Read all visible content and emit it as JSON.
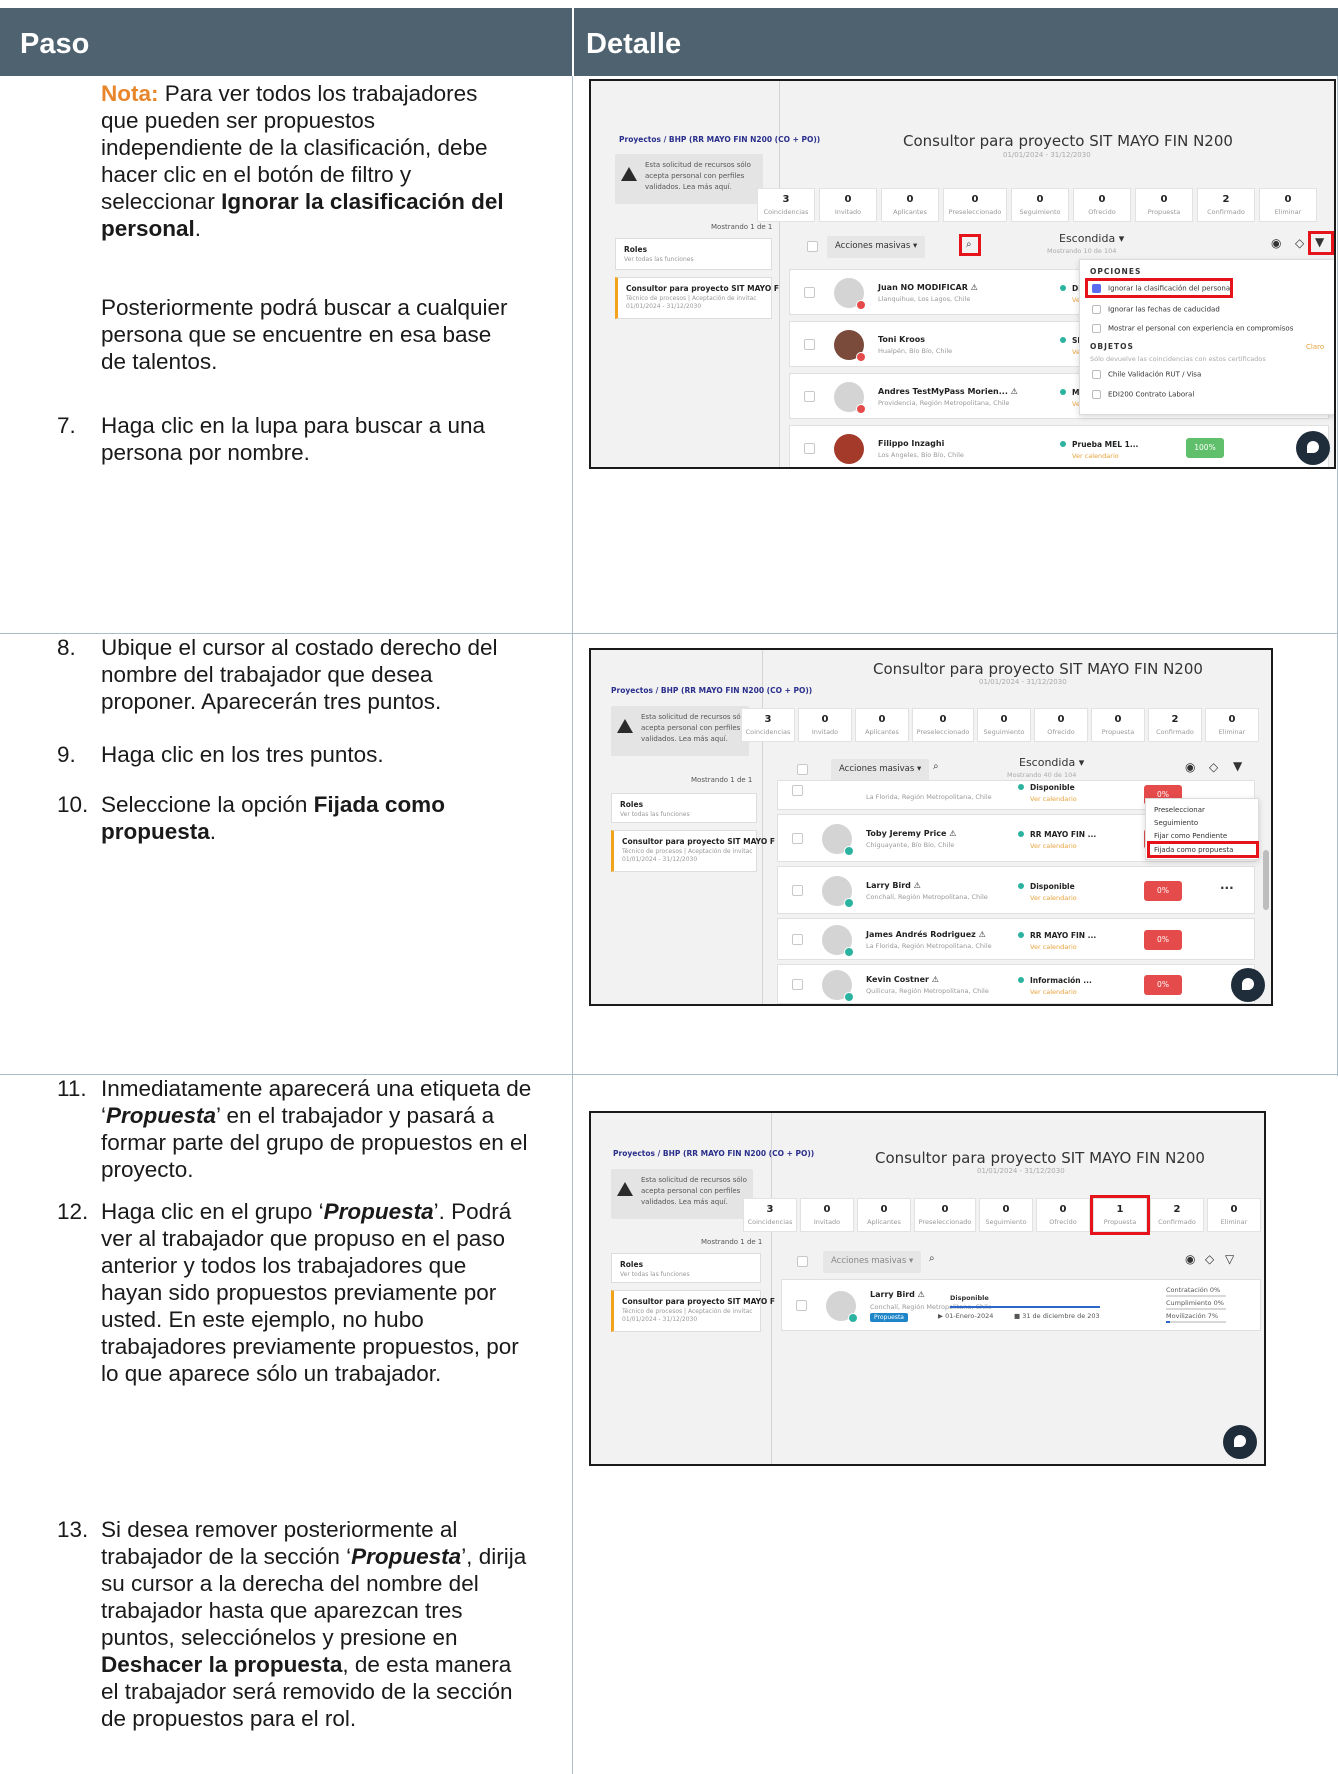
{
  "table": {
    "col1_header": "Paso",
    "col2_header": "Detalle"
  },
  "row1": {
    "note_label": "Nota:",
    "note_text_1": "Para ver todos los trabajadores",
    "note_text_2": "que pueden ser propuestos",
    "note_text_3": "independiente de la clasificación, debe",
    "note_text_4": "hacer clic en el botón de filtro y",
    "note_text_5": "seleccionar",
    "note_bold_1": "Ignorar la clasificación del",
    "note_bold_2": "personal",
    "note_period": ".",
    "later_1": "Posteriormente podrá buscar a cualquier",
    "later_2": "persona que se encuentre en esa base",
    "later_3": "de talentos.",
    "step7_num": "7.",
    "step7_1": "Haga clic en la lupa para buscar a una",
    "step7_2": "persona por nombre."
  },
  "row2": {
    "step8_num": "8.",
    "step8_1": "Ubique el cursor al costado derecho del",
    "step8_2": "nombre del trabajador que desea",
    "step8_3": "proponer. Aparecerán tres puntos.",
    "step9_num": "9.",
    "step9_1": "Haga clic en los tres puntos.",
    "step10_num": "10.",
    "step10_1": "Seleccione la opción",
    "step10_bold_1": "Fijada como",
    "step10_bold_2": "propuesta",
    "step10_period": "."
  },
  "row3": {
    "step11_num": "11.",
    "step11_1": "Inmediatamente aparecerá una etiqueta de",
    "step11_q1": "‘",
    "step11_bold": "Propuesta",
    "step11_q2": "’ en el trabajador y pasará a",
    "step11_2": "formar parte del grupo de propuestos en el",
    "step11_3": "proyecto.",
    "step12_num": "12.",
    "step12_1a": "Haga clic en el grupo ‘",
    "step12_bold": "Propuesta",
    "step12_1b": "’. Podrá",
    "step12_2": "ver al trabajador que propuso en el paso",
    "step12_3": "anterior y todos los trabajadores que",
    "step12_4": "hayan sido propuestos previamente por",
    "step12_5": "usted. En este ejemplo, no hubo",
    "step12_6": "trabajadores previamente propuestos, por",
    "step12_7": "lo que aparece sólo un trabajador.",
    "step13_num": "13.",
    "step13_1": "Si desea remover posteriormente al",
    "step13_2a": "trabajador de la sección ‘",
    "step13_bold": "Propuesta",
    "step13_2b": "’, dirija",
    "step13_3": "su cursor a la derecha del nombre del",
    "step13_4": "trabajador hasta que aparezcan tres",
    "step13_5": "puntos, selecciónelos y presione en",
    "step13_bold2": "Deshacer la propuesta",
    "step13_6": ", de esta manera",
    "step13_7": "el trabajador será removido de la sección",
    "step13_8": "de propuestos para el rol."
  },
  "app": {
    "breadcrumb": "Proyectos  /  BHP (RR MAYO FIN N200 (CO + PO))",
    "notice_1": "Esta solicitud de recursos sólo",
    "notice_2": "acepta personal con perfiles",
    "notice_3": "validados. Lea más aquí.",
    "mostrando": "Mostrando 1 de 1",
    "roles_title": "Roles",
    "roles_sub": "Ver todas las funciones",
    "role_title": "Consultor para proyecto SIT MAYO F",
    "role_sub_1": "Técnico de procesos | Aceptación de invitac",
    "role_sub_2": "01/01/2024 - 31/12/2030",
    "page_title": "Consultor para proyecto SIT MAYO FIN N200",
    "page_dates": "01/01/2024 - 31/12/2030",
    "stats": [
      {
        "n": "3",
        "l": "Coincidencias"
      },
      {
        "n": "0",
        "l": "Invitado"
      },
      {
        "n": "0",
        "l": "Aplicantes"
      },
      {
        "n": "0",
        "l": "Preseleccionado"
      },
      {
        "n": "0",
        "l": "Seguimiento"
      },
      {
        "n": "0",
        "l": "Ofrecido"
      },
      {
        "n": "0",
        "l": "Propuesta"
      },
      {
        "n": "2",
        "l": "Confirmado"
      },
      {
        "n": "0",
        "l": "Eliminar"
      }
    ],
    "stats_after": [
      {
        "n": "3",
        "l": "Coincidencias"
      },
      {
        "n": "0",
        "l": "Invitado"
      },
      {
        "n": "0",
        "l": "Aplicantes"
      },
      {
        "n": "0",
        "l": "Preseleccionado"
      },
      {
        "n": "0",
        "l": "Seguimiento"
      },
      {
        "n": "0",
        "l": "Ofrecido"
      },
      {
        "n": "1",
        "l": "Propuesta"
      },
      {
        "n": "2",
        "l": "Confirmado"
      },
      {
        "n": "0",
        "l": "Eliminar"
      }
    ],
    "acciones": "Acciones masivas ▾",
    "escondida": "Escondida  ▾",
    "mostrando_104": "Mostrando 10 de 104",
    "mostrando_40": "Mostrando 40 de 104",
    "search_icon": "search-icon",
    "globe_icon": "globe-icon",
    "tag_icon": "tag-icon",
    "filter_icon": "filter-icon"
  },
  "shot1": {
    "workers": [
      {
        "name": "Juan NO MODIFICAR  ⚠",
        "loc": "Llanquihue, Los Lagos, Chile",
        "status": "Disp",
        "cal": "Ver"
      },
      {
        "name": "Toni Kroos",
        "loc": "Hualpén, Bío Bío, Chile",
        "status": "SIT",
        "cal": "Ver"
      },
      {
        "name": "Andres TestMyPass Morien...  ⚠",
        "loc": "Providencia, Región Metropolitana, Chile",
        "status": "Mar",
        "cal": "Ver"
      },
      {
        "name": "Filippo Inzaghi",
        "loc": "Los Angeles, Bío Bío, Chile",
        "status": "Prueba MEL 1...",
        "cal": "Ver calendario",
        "pct": "100%"
      }
    ],
    "opciones": "OPCIONES",
    "opt_1": "Ignorar la clasificación del personal",
    "opt_2": "Ignorar las fechas de caducidad",
    "opt_3": "Mostrar el personal con experiencia en compromisos",
    "objetos": "OBJETOS",
    "claro": "Claro",
    "obj_sub": "Sólo devuelve las coincidencias con estos certificados",
    "obj_1": "Chile Validación RUT / Visa",
    "obj_2": "EDI200 Contrato Laboral"
  },
  "shot2": {
    "workers": [
      {
        "name": "Toby Jeremy Price  ⚠",
        "loc": "Chiguayante, Bío Bío, Chile",
        "status": "RR MAYO FIN ...",
        "cal": "Ver calendario",
        "pct": "0%"
      },
      {
        "name": "Larry Bird  ⚠",
        "loc": "Conchalí, Región Metropolitana, Chile",
        "status": "Disponible",
        "cal": "Ver calendario",
        "pct": "0%"
      },
      {
        "name": "James Andrés Rodriguez  ⚠",
        "loc": "La Florida, Región Metropolitana, Chile",
        "status": "RR MAYO FIN ...",
        "cal": "Ver calendario",
        "pct": "0%"
      },
      {
        "name": "Kevin Costner  ⚠",
        "loc": "Quilicura, Región Metropolitana, Chile",
        "status": "Información ...",
        "cal": "Ver calendario",
        "pct": "0%"
      }
    ],
    "top_loc": "La Florida, Región Metropolitana, Chile",
    "top_status": "Disponible",
    "top_cal": "Ver calendario",
    "top_pct": "0%",
    "menu_1": "Preseleccionar",
    "menu_2": "Seguimiento",
    "menu_3": "Fijar como Pendiente",
    "menu_4": "Fijada como propuesta",
    "dots": "···"
  },
  "shot3": {
    "name": "Larry Bird  ⚠",
    "loc": "Conchalí, Región Metropolitana, Chile",
    "tag": "Propuesta",
    "status": "Disponible",
    "date_1": "▶  01-Enero-2024",
    "date_2": "■  31 de diciembre de 203",
    "m1": "Contratación      0%",
    "m2": "Cumplimiento      0%",
    "m3": "Movilización        7%"
  }
}
